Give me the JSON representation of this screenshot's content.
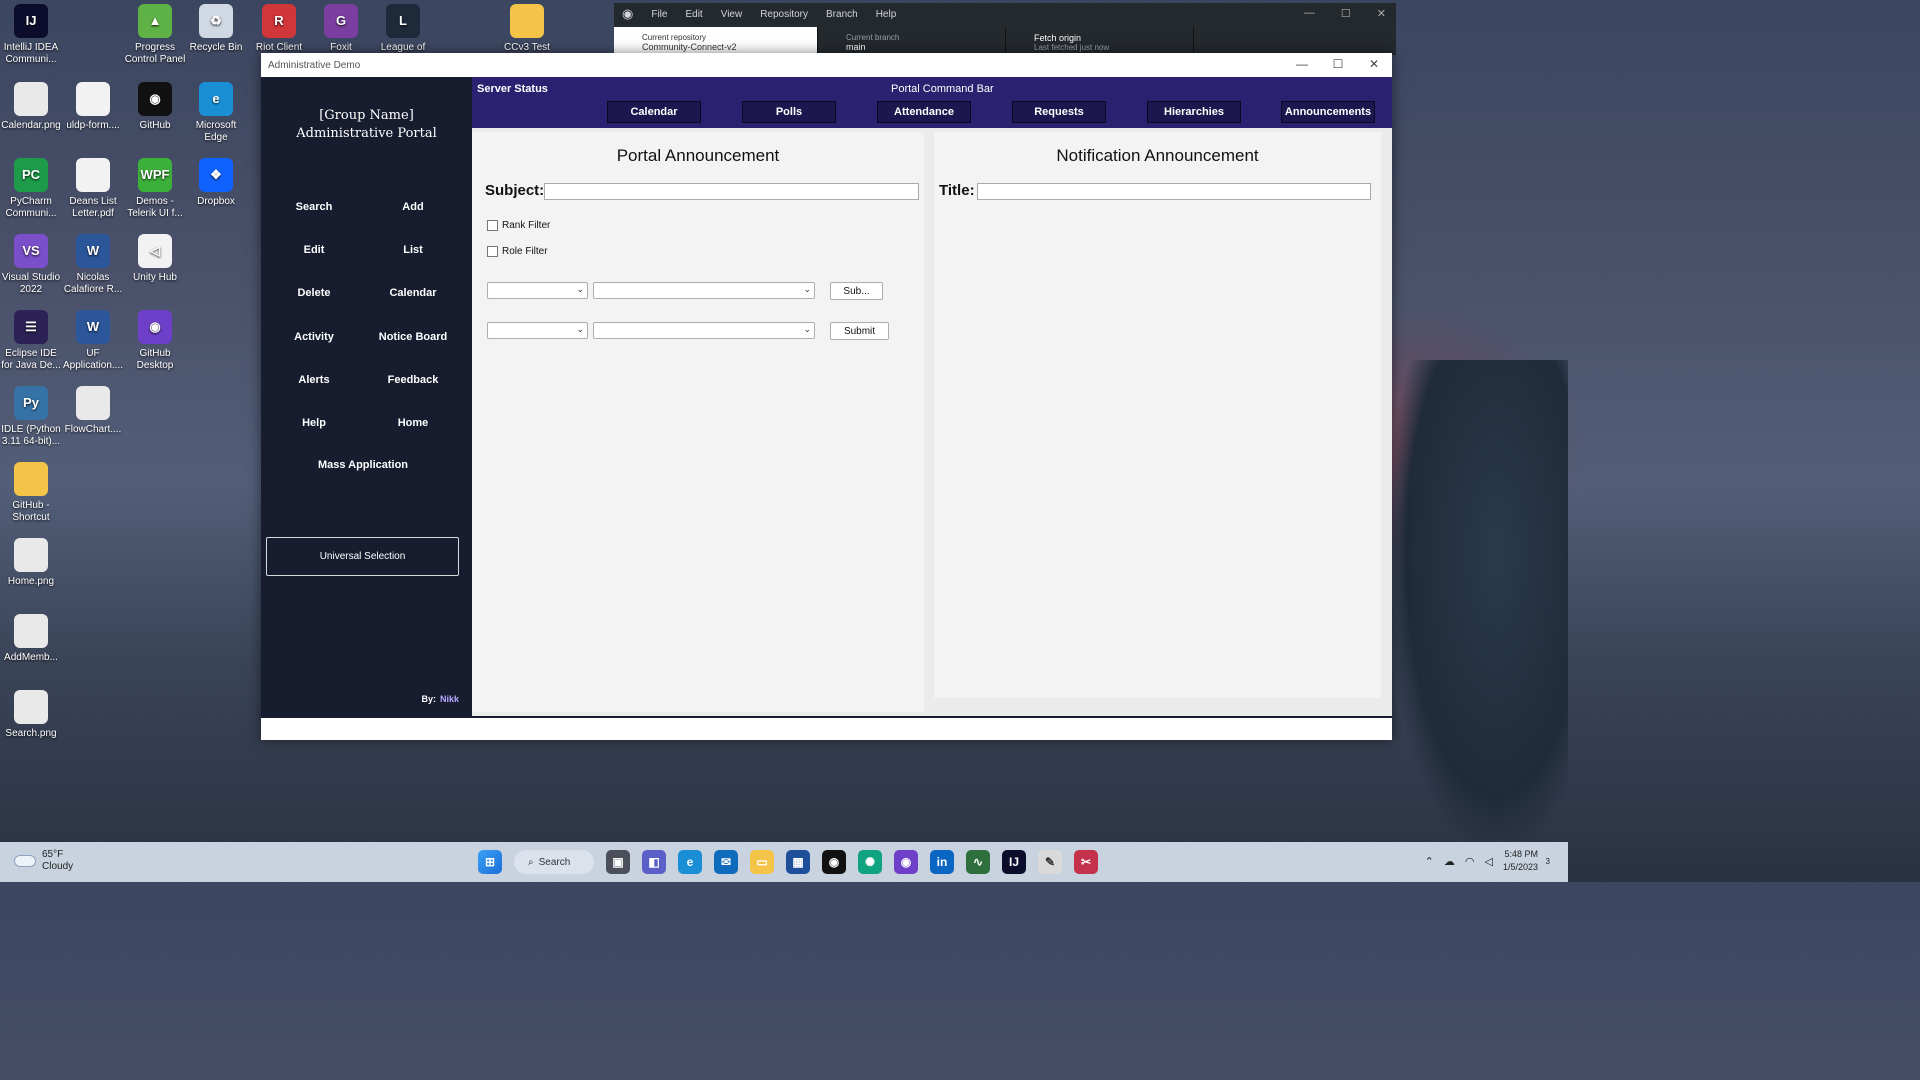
{
  "desktop": {
    "icons": [
      {
        "label": "IntelliJ IDEA Communi...",
        "name": "intellij-icon",
        "color": "#0c0c2c",
        "glyph": "IJ"
      },
      {
        "label": "Progress Control Panel",
        "name": "progress-control-panel-icon",
        "color": "#5fb246",
        "glyph": "▲"
      },
      {
        "label": "Recycle Bin",
        "name": "recycle-bin-icon",
        "color": "#cfd8e3",
        "glyph": "♻"
      },
      {
        "label": "Riot Client",
        "name": "riot-client-icon",
        "color": "#d13639",
        "glyph": "R"
      },
      {
        "label": "Foxit",
        "name": "foxit-icon",
        "color": "#7a3fa0",
        "glyph": "G"
      },
      {
        "label": "League of",
        "name": "league-of-legends-icon",
        "color": "#1e2a3a",
        "glyph": "L"
      },
      {
        "label": "CCv3 Test",
        "name": "folder-icon",
        "color": "#f3c447",
        "glyph": ""
      },
      {
        "label": "Calendar.png",
        "name": "image-file-icon",
        "color": "#e9e9e9",
        "glyph": ""
      },
      {
        "label": "uldp-form....",
        "name": "document-icon",
        "color": "#f2f2f2",
        "glyph": ""
      },
      {
        "label": "GitHub",
        "name": "github-icon",
        "color": "#111111",
        "glyph": "◉"
      },
      {
        "label": "Microsoft Edge",
        "name": "edge-icon",
        "color": "#1b8fd6",
        "glyph": "e"
      },
      {
        "label": "PyCharm Communi...",
        "name": "pycharm-icon",
        "color": "#1e9b4a",
        "glyph": "PC"
      },
      {
        "label": "Deans List Letter.pdf",
        "name": "pdf-file-icon",
        "color": "#f2f2f2",
        "glyph": ""
      },
      {
        "label": "Demos - Telerik UI f...",
        "name": "wpf-icon",
        "color": "#3cb13a",
        "glyph": "WPF"
      },
      {
        "label": "Dropbox",
        "name": "dropbox-icon",
        "color": "#0f62fe",
        "glyph": "❖"
      },
      {
        "label": "Visual Studio 2022",
        "name": "visual-studio-icon",
        "color": "#7b4fc9",
        "glyph": "VS"
      },
      {
        "label": "Nicolas Calafiore R...",
        "name": "word-document-icon",
        "color": "#2b579a",
        "glyph": "W"
      },
      {
        "label": "Unity Hub",
        "name": "unity-hub-icon",
        "color": "#f2f2f2",
        "glyph": "◁"
      },
      {
        "label": "Eclipse IDE for Java De...",
        "name": "eclipse-icon",
        "color": "#2c2255",
        "glyph": "☰"
      },
      {
        "label": "UF Application....",
        "name": "word-document-icon",
        "color": "#2b579a",
        "glyph": "W"
      },
      {
        "label": "GitHub Desktop",
        "name": "github-desktop-icon",
        "color": "#6e40c9",
        "glyph": "◉"
      },
      {
        "label": "IDLE (Python 3.11 64-bit)...",
        "name": "python-idle-icon",
        "color": "#3572a5",
        "glyph": "Py"
      },
      {
        "label": "FlowChart....",
        "name": "image-file-icon",
        "color": "#e9e9e9",
        "glyph": ""
      },
      {
        "label": "GitHub - Shortcut",
        "name": "folder-icon",
        "color": "#f3c447",
        "glyph": ""
      },
      {
        "label": "Home.png",
        "name": "image-file-icon",
        "color": "#e9e9e9",
        "glyph": ""
      },
      {
        "label": "AddMemb...",
        "name": "image-file-icon",
        "color": "#e9e9e9",
        "glyph": ""
      },
      {
        "label": "Search.png",
        "name": "image-file-icon",
        "color": "#e9e9e9",
        "glyph": ""
      }
    ]
  },
  "github_window": {
    "menu": [
      "File",
      "Edit",
      "View",
      "Repository",
      "Branch",
      "Help"
    ],
    "repo_label": "Current repository",
    "repo_value": "Community-Connect-v2",
    "branch_label": "Current branch",
    "branch_value": "main",
    "fetch_label": "Fetch origin",
    "fetch_sub": "Last fetched just now"
  },
  "app": {
    "window_title": "Administrative Demo",
    "sidebar": {
      "title_line1": "[Group Name]",
      "title_line2": "Administrative Portal",
      "buttons": [
        "Search",
        "Add",
        "Edit",
        "List",
        "Delete",
        "Calendar",
        "Activity",
        "Notice Board",
        "Alerts",
        "Feedback",
        "Help",
        "Home"
      ],
      "mass_application": "Mass Application",
      "universal_selection": "Universal Selection",
      "by_label": "By:",
      "author": "Nikk"
    },
    "command_bar": {
      "server_status": "Server Status",
      "title": "Portal Command Bar",
      "buttons": [
        "Calendar",
        "Polls",
        "Attendance",
        "Requests",
        "Hierarchies",
        "Announcements"
      ]
    },
    "portal_announcement": {
      "heading": "Portal Announcement",
      "subject_label": "Subject:",
      "subject_value": "",
      "rank_filter": "Rank Filter",
      "role_filter": "Role Filter",
      "row1_button": "Sub...",
      "row2_button": "Submit"
    },
    "notification_announcement": {
      "heading": "Notification Announcement",
      "title_label": "Title:",
      "title_value": ""
    }
  },
  "taskbar": {
    "weather_temp": "65°F",
    "weather_desc": "Cloudy",
    "search_label": "Search",
    "time": "5:48 PM",
    "date": "1/5/2023",
    "notification_count": "3"
  },
  "colors": {
    "sidebar_bg": "#171d2e",
    "command_bar_bg": "#2a2270",
    "command_button_bg": "#1c174e",
    "author_accent": "#b9a7ff"
  }
}
